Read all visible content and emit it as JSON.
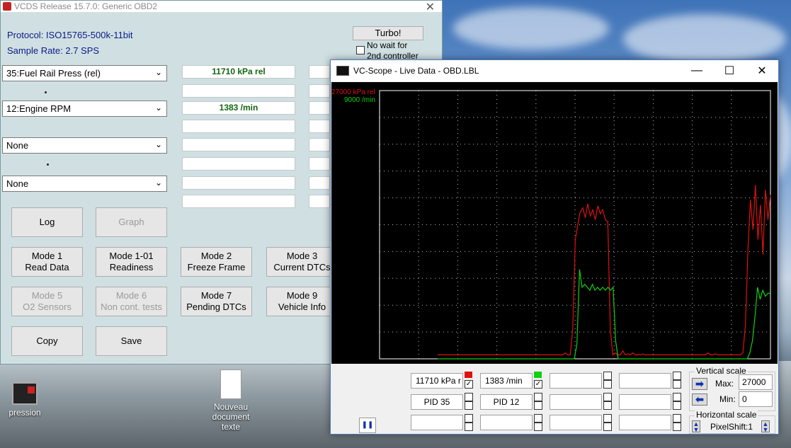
{
  "desktop": {
    "icons": [
      {
        "label": "pression"
      },
      {
        "label": "Nouveau document texte"
      }
    ]
  },
  "vcds": {
    "title": "VCDS Release 15.7.0:  Generic OBD2",
    "close_glyph": "✕",
    "protocol": "Protocol: ISO15765-500k-11bit",
    "sample_rate": "Sample Rate: 2.7 SPS",
    "turbo_label": "Turbo!",
    "no_wait_label_1": "No wait for",
    "no_wait_label_2": "2nd controller",
    "pid_selectors": [
      {
        "value": "35:Fuel Rail Press (rel)",
        "reading": "11710 kPa rel"
      },
      {
        "value": "12:Engine RPM",
        "reading": "1383 /min"
      },
      {
        "value": "None",
        "reading": ""
      },
      {
        "value": "None",
        "reading": ""
      }
    ],
    "buttons": {
      "log": "Log",
      "graph": "Graph",
      "mode1_a": "Mode 1",
      "mode1_b": "Read Data",
      "mode101_a": "Mode 1-01",
      "mode101_b": "Readiness",
      "mode2_a": "Mode 2",
      "mode2_b": "Freeze Frame",
      "mode3_a": "Mode 3",
      "mode3_b": "Current DTCs",
      "mode5_a": "Mode 5",
      "mode5_b": "O2 Sensors",
      "mode6_a": "Mode 6",
      "mode6_b": "Non cont. tests",
      "mode7_a": "Mode 7",
      "mode7_b": "Pending DTCs",
      "mode9_a": "Mode 9",
      "mode9_b": "Vehicle Info",
      "copy": "Copy",
      "save": "Save"
    }
  },
  "scope": {
    "title": "VC-Scope  -  Live Data  -  OBD.LBL",
    "minimize_glyph": "—",
    "maximize_glyph": "☐",
    "close_glyph": "✕",
    "series1_label": "27000 kPa rel",
    "series2_label": "9000 /min",
    "series1_color": "#e01010",
    "series2_color": "#10d010",
    "field1": "11710 kPa r",
    "field2": "1383 /min",
    "pid1": "PID 35",
    "pid2": "PID 12",
    "vertical_scale_label": "Vertical scale",
    "max_label": "Max:",
    "max_value": "27000",
    "min_label": "Min:",
    "min_value": "0",
    "horizontal_scale_label": "Horizontal scale",
    "pixelshift_label": "PixelShift:1",
    "pause_glyph": "❚❚"
  },
  "chart_data": {
    "type": "line",
    "title": "",
    "xlabel": "",
    "ylabel": "",
    "grid": true,
    "series": [
      {
        "name": "27000 kPa rel",
        "ylim": [
          0,
          27000
        ],
        "values": [
          400,
          400,
          400,
          400,
          400,
          400,
          400,
          400,
          400,
          400,
          400,
          400,
          400,
          400,
          400,
          400,
          400,
          400,
          400,
          400,
          400,
          400,
          400,
          400,
          400,
          400,
          400,
          400,
          400,
          400,
          400,
          400,
          400,
          400,
          400,
          400,
          400,
          400,
          400,
          400,
          400,
          400,
          400,
          400,
          400,
          400,
          400,
          400,
          400,
          400,
          400,
          600,
          400,
          400,
          3000,
          12000,
          13500,
          14800,
          15200,
          14200,
          15600,
          14400,
          15000,
          14000,
          15400,
          14600,
          15000,
          14000,
          13800,
          3000,
          400,
          600,
          400,
          400,
          800,
          400,
          500,
          400,
          600,
          400,
          400,
          400,
          500,
          400,
          400,
          400,
          400,
          400,
          400,
          400,
          400,
          400,
          400,
          400,
          400,
          400,
          400,
          400,
          400,
          400,
          400,
          400,
          400,
          400,
          400,
          400,
          400,
          400,
          600,
          400,
          400,
          500,
          400,
          400,
          400,
          400,
          400,
          400,
          400,
          400,
          400,
          400,
          600,
          3500,
          11000,
          16000,
          13000,
          17500,
          12000,
          15500,
          10500,
          17000,
          14000,
          16500
        ]
      },
      {
        "name": "9000 /min",
        "ylim": [
          0,
          9000
        ],
        "values": [
          0,
          0,
          0,
          0,
          0,
          0,
          0,
          0,
          0,
          0,
          0,
          0,
          0,
          0,
          0,
          0,
          0,
          0,
          0,
          0,
          0,
          0,
          0,
          0,
          0,
          0,
          0,
          0,
          0,
          0,
          0,
          0,
          0,
          0,
          0,
          0,
          0,
          0,
          0,
          0,
          0,
          0,
          0,
          0,
          0,
          0,
          0,
          0,
          0,
          0,
          0,
          0,
          0,
          0,
          500,
          3000,
          2400,
          2500,
          2400,
          2300,
          2500,
          2300,
          2400,
          2300,
          2400,
          2300,
          2400,
          2300,
          2400,
          600,
          0,
          0,
          0,
          0,
          0,
          0,
          0,
          0,
          0,
          0,
          0,
          0,
          0,
          0,
          0,
          0,
          0,
          0,
          0,
          0,
          0,
          0,
          0,
          0,
          0,
          0,
          0,
          0,
          0,
          0,
          0,
          0,
          0,
          0,
          0,
          0,
          0,
          0,
          0,
          0,
          0,
          0,
          0,
          0,
          0,
          0,
          0,
          0,
          0,
          0,
          0,
          200,
          600,
          1400,
          2400,
          2000,
          2300,
          2100,
          2200,
          2200
        ]
      }
    ]
  }
}
